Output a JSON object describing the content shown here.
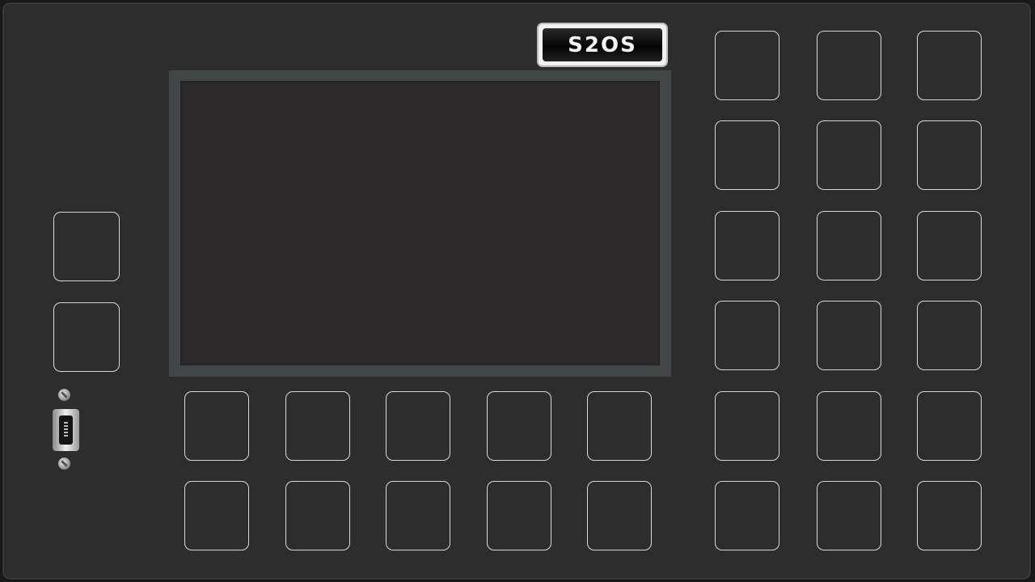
{
  "device": {
    "brand_label": "S2OS"
  },
  "controls": {
    "left_column_count": 2,
    "bottom_grid_count": 10,
    "right_grid_count": 18
  }
}
